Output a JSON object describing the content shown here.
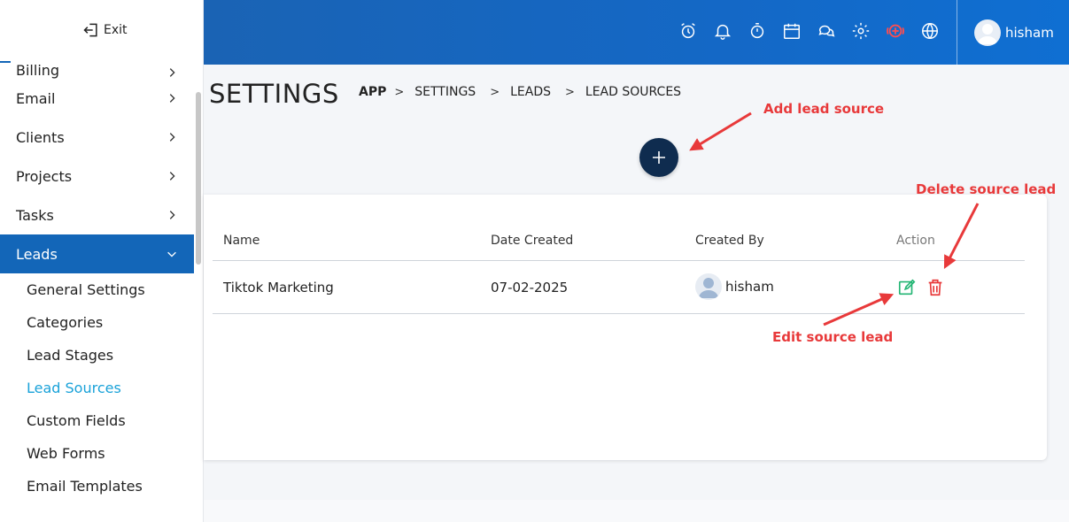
{
  "sidebar": {
    "exit_label": "Exit",
    "items": [
      {
        "label": "Billing"
      },
      {
        "label": "Email"
      },
      {
        "label": "Clients"
      },
      {
        "label": "Projects"
      },
      {
        "label": "Tasks"
      },
      {
        "label": "Leads"
      }
    ],
    "subitems": [
      {
        "label": "General Settings"
      },
      {
        "label": "Categories"
      },
      {
        "label": "Lead Stages"
      },
      {
        "label": "Lead Sources"
      },
      {
        "label": "Custom Fields"
      },
      {
        "label": "Web Forms"
      },
      {
        "label": "Email Templates"
      }
    ]
  },
  "header": {
    "icons": [
      "alarm-icon",
      "bell-icon",
      "stopwatch-icon",
      "calendar-icon",
      "chat-icon",
      "gear-icon",
      "add-circle-icon",
      "globe-icon"
    ],
    "username": "hisham"
  },
  "page": {
    "title": "SETTINGS",
    "breadcrumb": [
      "APP",
      "SETTINGS",
      "LEADS",
      "LEAD SOURCES"
    ]
  },
  "table": {
    "columns": [
      "Name",
      "Date Created",
      "Created By",
      "Action"
    ],
    "rows": [
      {
        "name": "Tiktok Marketing",
        "date": "07-02-2025",
        "created_by": "hisham"
      }
    ]
  },
  "annotations": {
    "add": "Add lead source",
    "delete": "Delete source lead",
    "edit": "Edit source lead"
  },
  "colors": {
    "primary": "#1366b8",
    "header": "#1468c6",
    "add_button": "#0f2c4f",
    "annotation": "#e8393a",
    "edit_icon": "#22b573",
    "delete_icon": "#e8393a",
    "active_submenu": "#1aa2d9"
  }
}
